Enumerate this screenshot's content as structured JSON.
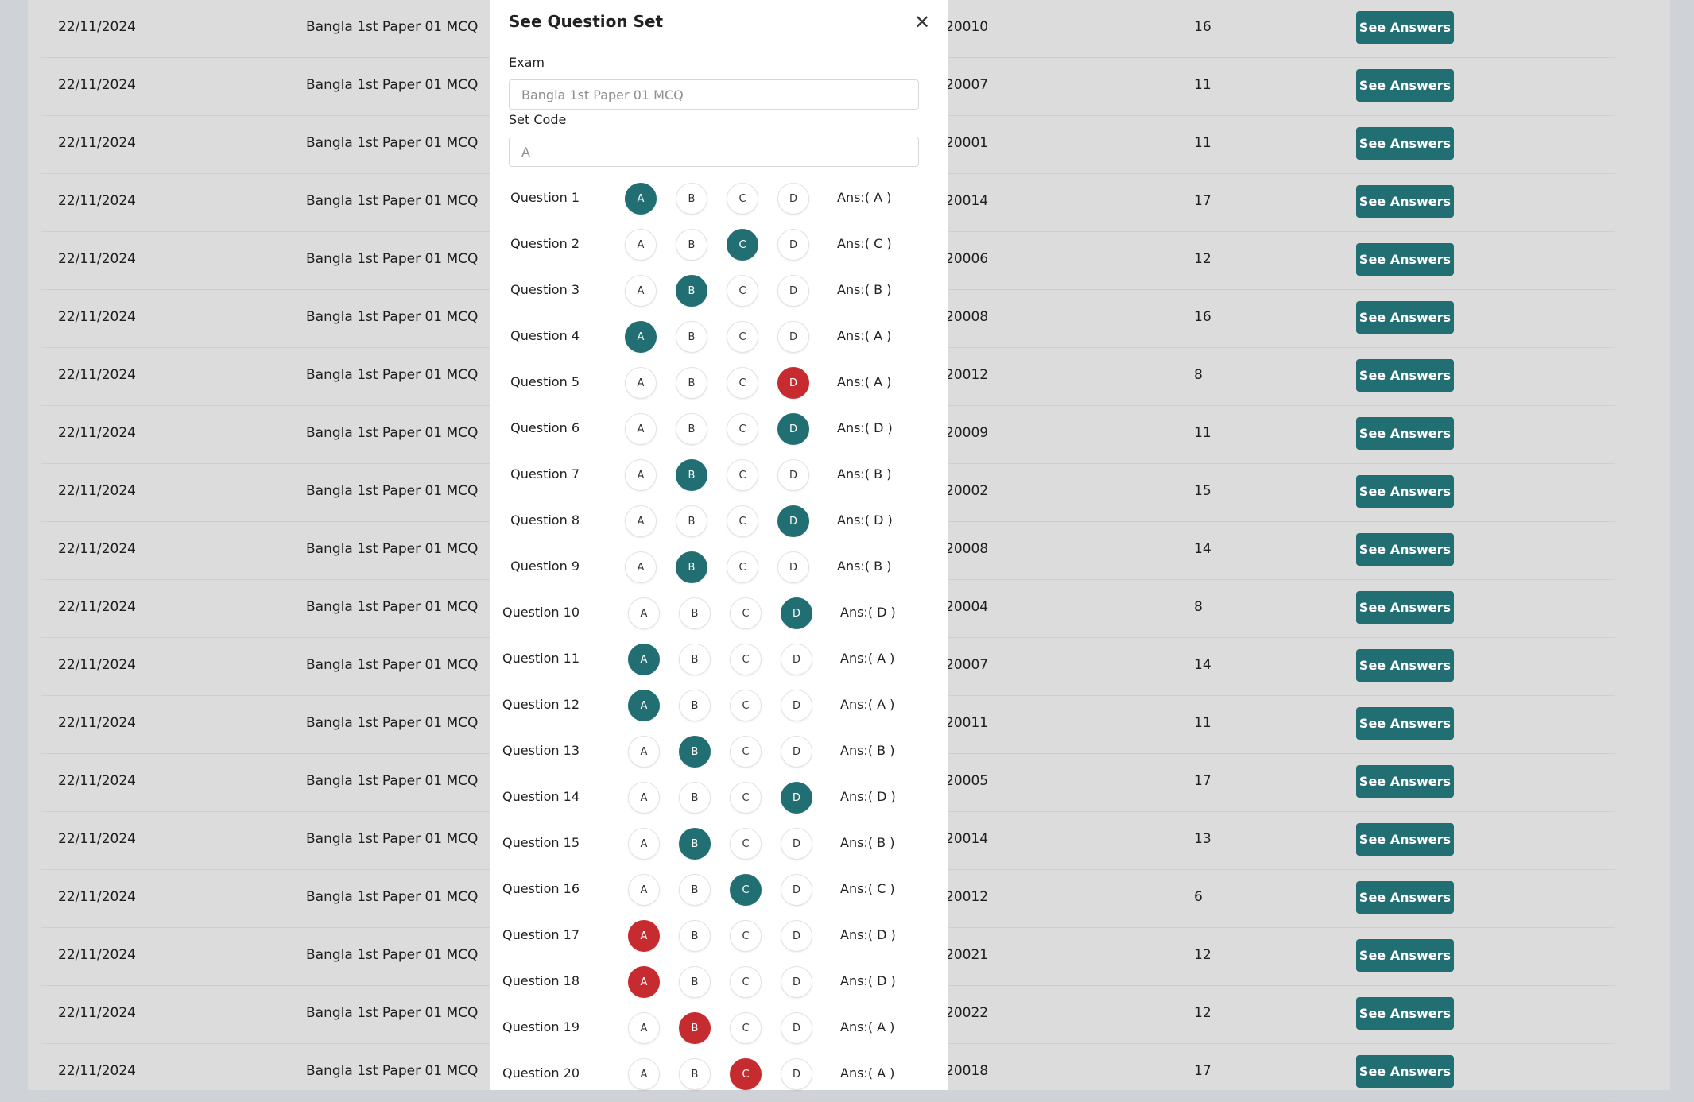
{
  "table": {
    "button_label": "See Answers",
    "rows": [
      {
        "date": "22/11/2024",
        "exam": "Bangla 1st Paper 01 MCQ",
        "roll": "20010",
        "marks": "16"
      },
      {
        "date": "22/11/2024",
        "exam": "Bangla 1st Paper 01 MCQ",
        "roll": "20007",
        "marks": "11"
      },
      {
        "date": "22/11/2024",
        "exam": "Bangla 1st Paper 01 MCQ",
        "roll": "20001",
        "marks": "11"
      },
      {
        "date": "22/11/2024",
        "exam": "Bangla 1st Paper 01 MCQ",
        "roll": "20014",
        "marks": "17"
      },
      {
        "date": "22/11/2024",
        "exam": "Bangla 1st Paper 01 MCQ",
        "roll": "20006",
        "marks": "12"
      },
      {
        "date": "22/11/2024",
        "exam": "Bangla 1st Paper 01 MCQ",
        "roll": "20008",
        "marks": "16"
      },
      {
        "date": "22/11/2024",
        "exam": "Bangla 1st Paper 01 MCQ",
        "roll": "20012",
        "marks": "8"
      },
      {
        "date": "22/11/2024",
        "exam": "Bangla 1st Paper 01 MCQ",
        "roll": "20009",
        "marks": "11"
      },
      {
        "date": "22/11/2024",
        "exam": "Bangla 1st Paper 01 MCQ",
        "roll": "20002",
        "marks": "15"
      },
      {
        "date": "22/11/2024",
        "exam": "Bangla 1st Paper 01 MCQ",
        "roll": "20008",
        "marks": "14"
      },
      {
        "date": "22/11/2024",
        "exam": "Bangla 1st Paper 01 MCQ",
        "roll": "20004",
        "marks": "8"
      },
      {
        "date": "22/11/2024",
        "exam": "Bangla 1st Paper 01 MCQ",
        "roll": "20007",
        "marks": "14"
      },
      {
        "date": "22/11/2024",
        "exam": "Bangla 1st Paper 01 MCQ",
        "roll": "20011",
        "marks": "11"
      },
      {
        "date": "22/11/2024",
        "exam": "Bangla 1st Paper 01 MCQ",
        "roll": "20005",
        "marks": "17"
      },
      {
        "date": "22/11/2024",
        "exam": "Bangla 1st Paper 01 MCQ",
        "roll": "20014",
        "marks": "13"
      },
      {
        "date": "22/11/2024",
        "exam": "Bangla 1st Paper 01 MCQ",
        "roll": "20012",
        "marks": "6"
      },
      {
        "date": "22/11/2024",
        "exam": "Bangla 1st Paper 01 MCQ",
        "roll": "20021",
        "marks": "12"
      },
      {
        "date": "22/11/2024",
        "exam": "Bangla 1st Paper 01 MCQ",
        "roll": "20022",
        "marks": "12"
      },
      {
        "date": "22/11/2024",
        "exam": "Bangla 1st Paper 01 MCQ",
        "roll": "20018",
        "marks": "17"
      }
    ]
  },
  "modal": {
    "title": "See Question Set",
    "close_icon": "close-icon",
    "exam_label": "Exam",
    "exam_placeholder": "Bangla 1st Paper 01 MCQ",
    "set_code_label": "Set Code",
    "set_code_placeholder": "A",
    "options": [
      "A",
      "B",
      "C",
      "D"
    ],
    "correct_color": "#226f73",
    "wrong_color": "#c62c2f",
    "questions": [
      {
        "label": "Question 1",
        "selected": "A",
        "status": "correct",
        "answer": "Ans:( A )"
      },
      {
        "label": "Question 2",
        "selected": "C",
        "status": "correct",
        "answer": "Ans:( C )"
      },
      {
        "label": "Question 3",
        "selected": "B",
        "status": "correct",
        "answer": "Ans:( B )"
      },
      {
        "label": "Question 4",
        "selected": "A",
        "status": "correct",
        "answer": "Ans:( A )"
      },
      {
        "label": "Question 5",
        "selected": "D",
        "status": "wrong",
        "answer": "Ans:( A )"
      },
      {
        "label": "Question 6",
        "selected": "D",
        "status": "correct",
        "answer": "Ans:( D )"
      },
      {
        "label": "Question 7",
        "selected": "B",
        "status": "correct",
        "answer": "Ans:( B )"
      },
      {
        "label": "Question 8",
        "selected": "D",
        "status": "correct",
        "answer": "Ans:( D )"
      },
      {
        "label": "Question 9",
        "selected": "B",
        "status": "correct",
        "answer": "Ans:( B )"
      },
      {
        "label": "Question 10",
        "selected": "D",
        "status": "correct",
        "answer": "Ans:( D )"
      },
      {
        "label": "Question 11",
        "selected": "A",
        "status": "correct",
        "answer": "Ans:( A )"
      },
      {
        "label": "Question 12",
        "selected": "A",
        "status": "correct",
        "answer": "Ans:( A )"
      },
      {
        "label": "Question 13",
        "selected": "B",
        "status": "correct",
        "answer": "Ans:( B )"
      },
      {
        "label": "Question 14",
        "selected": "D",
        "status": "correct",
        "answer": "Ans:( D )"
      },
      {
        "label": "Question 15",
        "selected": "B",
        "status": "correct",
        "answer": "Ans:( B )"
      },
      {
        "label": "Question 16",
        "selected": "C",
        "status": "correct",
        "answer": "Ans:( C )"
      },
      {
        "label": "Question 17",
        "selected": "A",
        "status": "wrong",
        "answer": "Ans:( D )"
      },
      {
        "label": "Question 18",
        "selected": "A",
        "status": "wrong",
        "answer": "Ans:( D )"
      },
      {
        "label": "Question 19",
        "selected": "B",
        "status": "wrong",
        "answer": "Ans:( A )"
      },
      {
        "label": "Question 20",
        "selected": "C",
        "status": "wrong",
        "answer": "Ans:( A )"
      }
    ]
  }
}
